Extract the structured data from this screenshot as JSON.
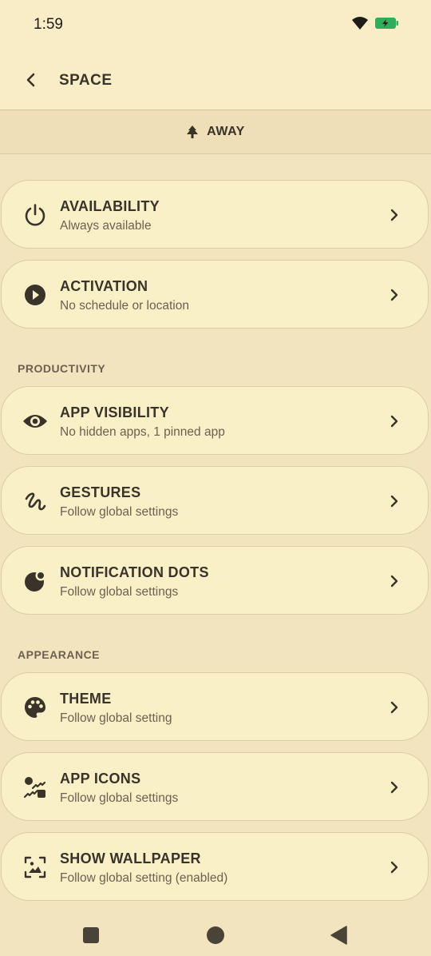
{
  "status_bar": {
    "time": "1:59"
  },
  "header": {
    "title": "SPACE"
  },
  "mode": {
    "label": "AWAY"
  },
  "cards": [
    {
      "title": "AVAILABILITY",
      "subtitle": "Always available",
      "icon": "power-icon"
    },
    {
      "title": "ACTIVATION",
      "subtitle": "No schedule or location",
      "icon": "play-circle-icon"
    }
  ],
  "productivity": {
    "header": "PRODUCTIVITY",
    "items": [
      {
        "title": "APP VISIBILITY",
        "subtitle": "No hidden apps, 1 pinned app",
        "icon": "eye-icon"
      },
      {
        "title": "GESTURES",
        "subtitle": "Follow global settings",
        "icon": "gesture-icon"
      },
      {
        "title": "NOTIFICATION DOTS",
        "subtitle": "Follow global settings",
        "icon": "notification-dot-icon"
      }
    ]
  },
  "appearance": {
    "header": "APPEARANCE",
    "items": [
      {
        "title": "THEME",
        "subtitle": "Follow global setting",
        "icon": "palette-icon"
      },
      {
        "title": "APP ICONS",
        "subtitle": "Follow global settings",
        "icon": "app-icons-icon"
      },
      {
        "title": "SHOW WALLPAPER",
        "subtitle": "Follow global setting (enabled)",
        "icon": "wallpaper-icon"
      }
    ]
  },
  "colors": {
    "background": "#F2E4BE",
    "card": "#FAF0C8",
    "text": "#3A3329",
    "subtext": "#6C6150",
    "battery": "#2EAE5A"
  }
}
